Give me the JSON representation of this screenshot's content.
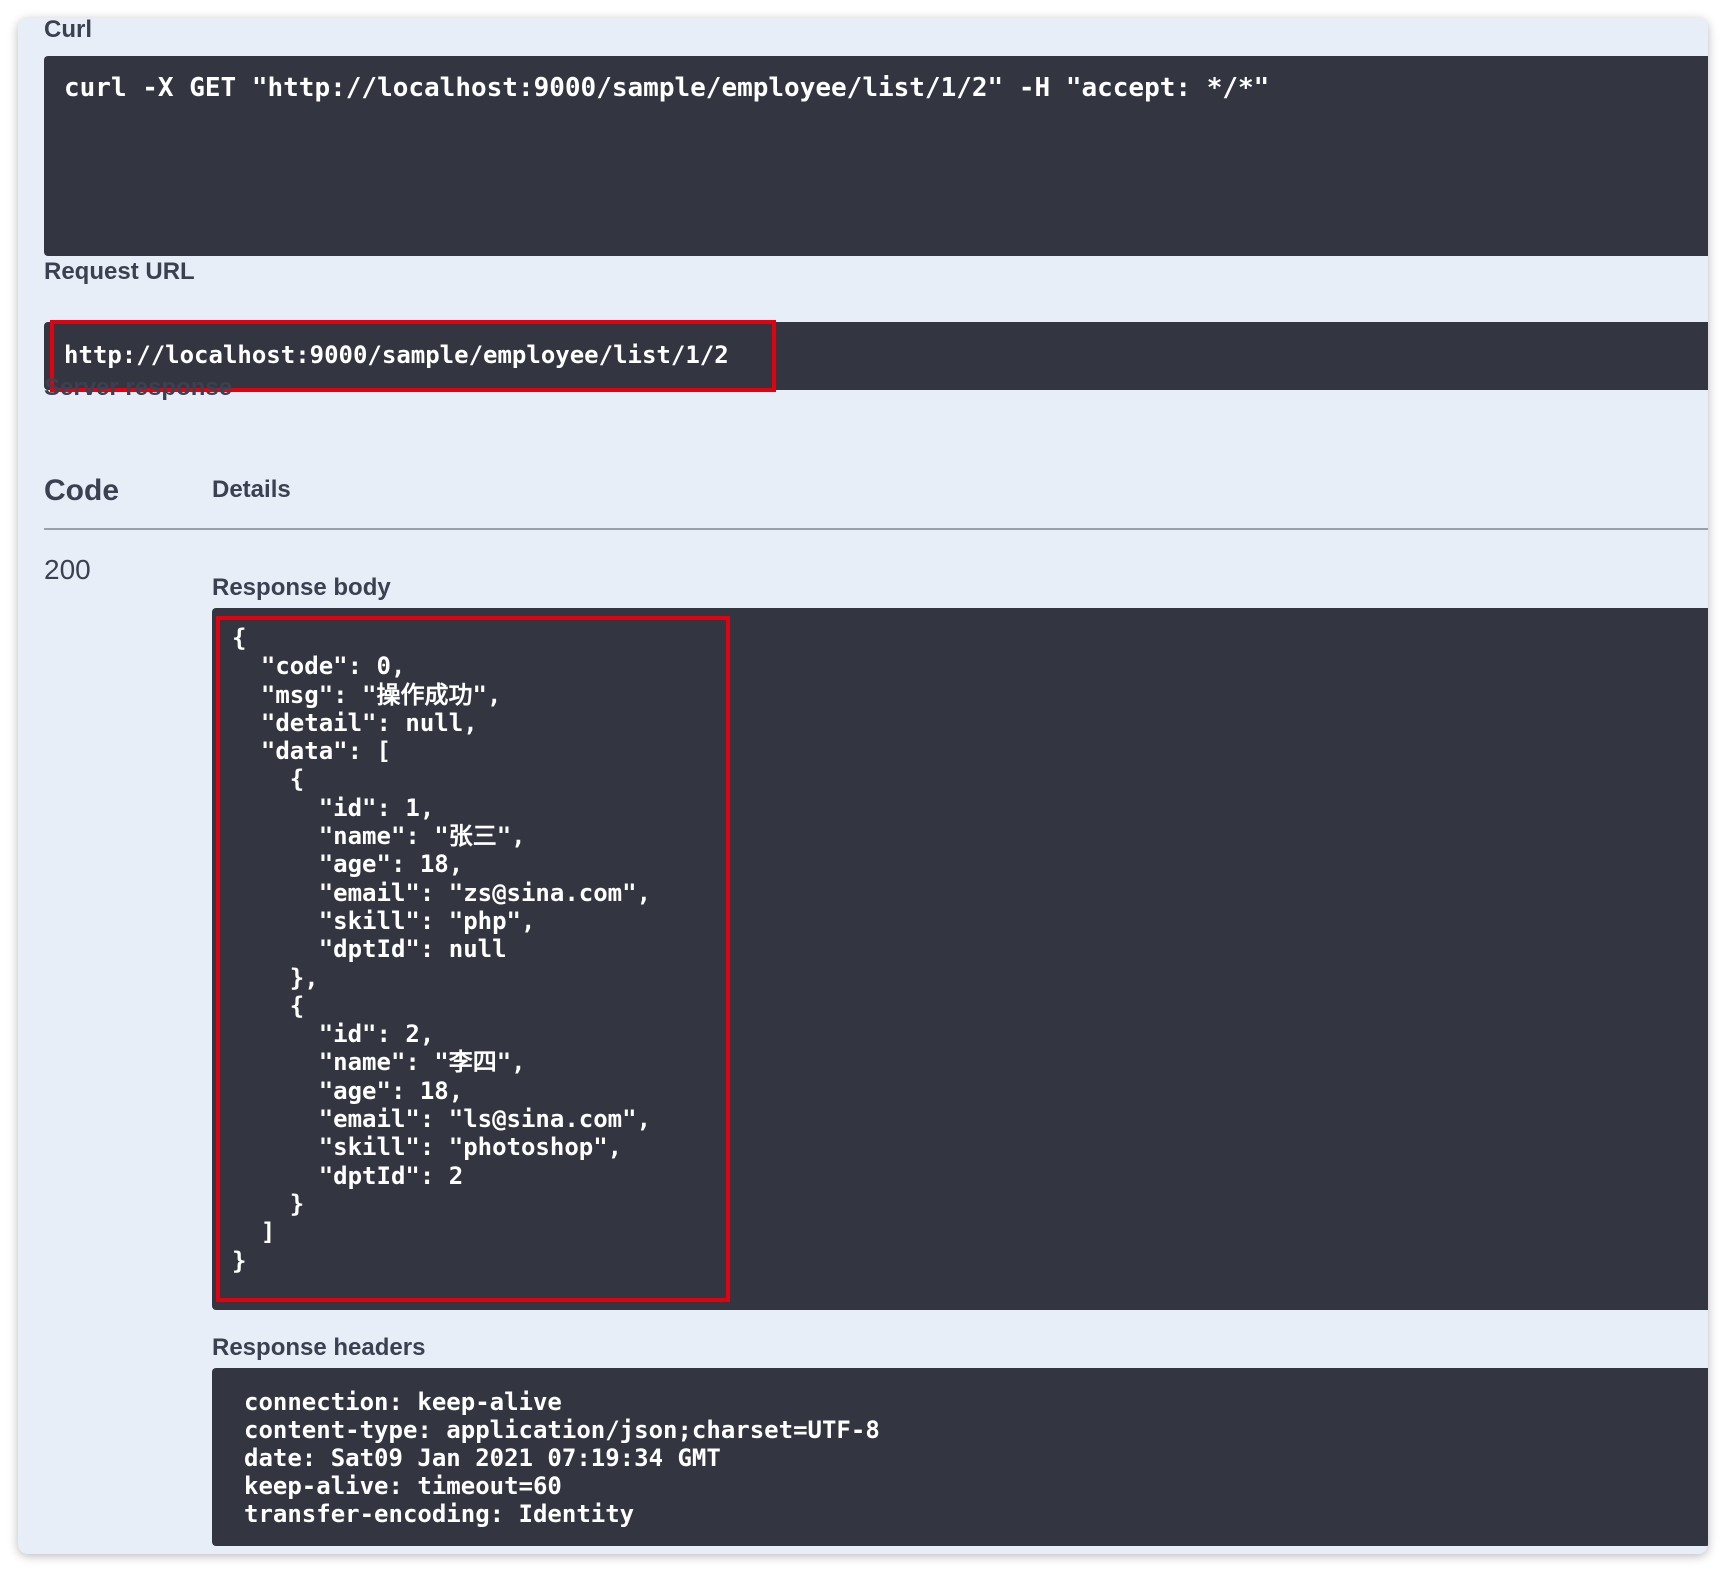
{
  "curl": {
    "label": "Curl",
    "command": "curl -X GET \"http://localhost:9000/sample/employee/list/1/2\" -H \"accept: */*\""
  },
  "request_url": {
    "label": "Request URL",
    "value": "http://localhost:9000/sample/employee/list/1/2"
  },
  "server_response": {
    "label": "Server response",
    "code_header": "Code",
    "details_header": "Details",
    "status_code": "200",
    "response_body_label": "Response body",
    "response_body": "{\n  \"code\": 0,\n  \"msg\": \"操作成功\",\n  \"detail\": null,\n  \"data\": [\n    {\n      \"id\": 1,\n      \"name\": \"张三\",\n      \"age\": 18,\n      \"email\": \"zs@sina.com\",\n      \"skill\": \"php\",\n      \"dptId\": null\n    },\n    {\n      \"id\": 2,\n      \"name\": \"李四\",\n      \"age\": 18,\n      \"email\": \"ls@sina.com\",\n      \"skill\": \"photoshop\",\n      \"dptId\": 2\n    }\n  ]\n}",
    "response_headers_label": "Response headers",
    "response_headers": "connection: keep-alive\ncontent-type: application/json;charset=UTF-8\ndate: Sat09 Jan 2021 07:19:34 GMT\nkeep-alive: timeout=60\ntransfer-encoding: Identity"
  },
  "colors": {
    "background": "#e8eef8",
    "code_block": "#333640",
    "highlight": "#e3000f",
    "text": "#3b4151"
  }
}
